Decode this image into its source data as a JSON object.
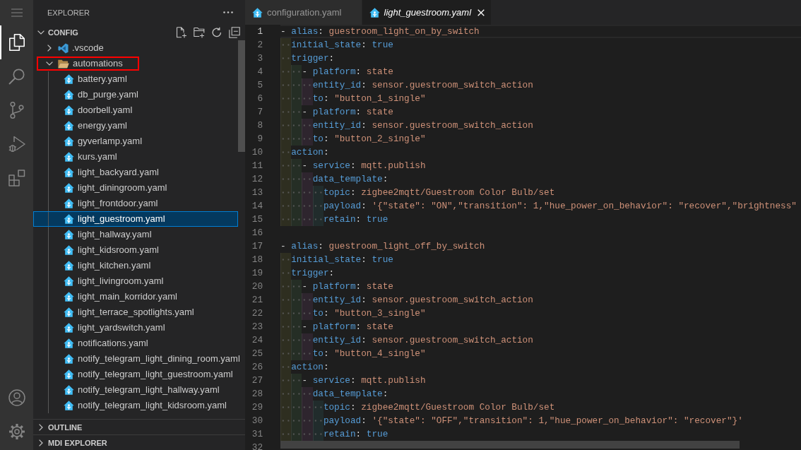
{
  "activity_bar": {
    "items": [
      {
        "kind": "explorer",
        "selected": true
      },
      {
        "kind": "search",
        "selected": false
      },
      {
        "kind": "scm",
        "selected": false
      },
      {
        "kind": "debug",
        "selected": false
      },
      {
        "kind": "extensions",
        "selected": false
      }
    ]
  },
  "sidebar": {
    "title": "EXPLORER",
    "sections": [
      {
        "title": "CONFIG",
        "expanded": true,
        "items": [
          {
            "label": ".vscode",
            "kind": "settings",
            "expanded": false,
            "selected": false,
            "outlined": false
          },
          {
            "label": "automations",
            "kind": "folder",
            "expanded": true,
            "selected": false,
            "outlined": true,
            "children": [
              {
                "label": "battery.yaml",
                "kind": "file",
                "selected": false
              },
              {
                "label": "db_purge.yaml",
                "kind": "file",
                "selected": false
              },
              {
                "label": "doorbell.yaml",
                "kind": "file",
                "selected": false
              },
              {
                "label": "energy.yaml",
                "kind": "file",
                "selected": false
              },
              {
                "label": "gyverlamp.yaml",
                "kind": "file",
                "selected": false
              },
              {
                "label": "kurs.yaml",
                "kind": "file",
                "selected": false
              },
              {
                "label": "light_backyard.yaml",
                "kind": "file",
                "selected": false
              },
              {
                "label": "light_diningroom.yaml",
                "kind": "file",
                "selected": false
              },
              {
                "label": "light_frontdoor.yaml",
                "kind": "file",
                "selected": false
              },
              {
                "label": "light_guestroom.yaml",
                "kind": "file",
                "selected": true
              },
              {
                "label": "light_hallway.yaml",
                "kind": "file",
                "selected": false
              },
              {
                "label": "light_kidsroom.yaml",
                "kind": "file",
                "selected": false
              },
              {
                "label": "light_kitchen.yaml",
                "kind": "file",
                "selected": false
              },
              {
                "label": "light_livingroom.yaml",
                "kind": "file",
                "selected": false
              },
              {
                "label": "light_main_korridor.yaml",
                "kind": "file",
                "selected": false
              },
              {
                "label": "light_terrace_spotlights.yaml",
                "kind": "file",
                "selected": false
              },
              {
                "label": "light_yardswitch.yaml",
                "kind": "file",
                "selected": false
              },
              {
                "label": "notifications.yaml",
                "kind": "file",
                "selected": false
              },
              {
                "label": "notify_telegram_light_dining_room.yaml",
                "kind": "file",
                "selected": false
              },
              {
                "label": "notify_telegram_light_guestroom.yaml",
                "kind": "file",
                "selected": false
              },
              {
                "label": "notify_telegram_light_hallway.yaml",
                "kind": "file",
                "selected": false
              },
              {
                "label": "notify_telegram_light_kidsroom.yaml",
                "kind": "file",
                "selected": false
              }
            ]
          }
        ]
      },
      {
        "title": "OUTLINE",
        "expanded": false
      },
      {
        "title": "MDI EXPLORER",
        "expanded": false
      }
    ]
  },
  "tabs": [
    {
      "label": "configuration.yaml",
      "selected": false,
      "preview": false
    },
    {
      "label": "light_guestroom.yaml",
      "selected": true,
      "preview": true
    }
  ],
  "editor": {
    "lines": [
      {
        "number": "1",
        "active": true,
        "tokens": [
          {
            "text": "- ",
            "kind": "punct"
          },
          {
            "text": "alias",
            "kind": "key"
          },
          {
            "text": ": ",
            "kind": "punct"
          },
          {
            "text": "guestroom_light_on_by_switch",
            "kind": "value"
          }
        ],
        "children": [
          {
            "number": "2",
            "active": false,
            "tokens": [
              {
                "text": "initial_state",
                "kind": "key"
              },
              {
                "text": ": ",
                "kind": "punct"
              },
              {
                "text": "true",
                "kind": "literal"
              }
            ]
          },
          {
            "number": "3",
            "active": false,
            "tokens": [
              {
                "text": "trigger",
                "kind": "key"
              },
              {
                "text": ":",
                "kind": "punct"
              }
            ],
            "children": [
              {
                "number": "4",
                "active": false,
                "tokens": [
                  {
                    "text": "- ",
                    "kind": "punct"
                  },
                  {
                    "text": "platform",
                    "kind": "key"
                  },
                  {
                    "text": ": ",
                    "kind": "punct"
                  },
                  {
                    "text": "state",
                    "kind": "value"
                  }
                ],
                "children": [
                  {
                    "number": "5",
                    "active": false,
                    "tokens": [
                      {
                        "text": "entity_id",
                        "kind": "key"
                      },
                      {
                        "text": ": ",
                        "kind": "punct"
                      },
                      {
                        "text": "sensor.guestroom_switch_action",
                        "kind": "value"
                      }
                    ]
                  },
                  {
                    "number": "6",
                    "active": false,
                    "tokens": [
                      {
                        "text": "to",
                        "kind": "key"
                      },
                      {
                        "text": ": ",
                        "kind": "punct"
                      },
                      {
                        "text": "\"button_1_single\"",
                        "kind": "value"
                      }
                    ]
                  }
                ]
              },
              {
                "number": "7",
                "active": false,
                "tokens": [
                  {
                    "text": "- ",
                    "kind": "punct"
                  },
                  {
                    "text": "platform",
                    "kind": "key"
                  },
                  {
                    "text": ": ",
                    "kind": "punct"
                  },
                  {
                    "text": "state",
                    "kind": "value"
                  }
                ],
                "children": [
                  {
                    "number": "8",
                    "active": false,
                    "tokens": [
                      {
                        "text": "entity_id",
                        "kind": "key"
                      },
                      {
                        "text": ": ",
                        "kind": "punct"
                      },
                      {
                        "text": "sensor.guestroom_switch_action",
                        "kind": "value"
                      }
                    ]
                  },
                  {
                    "number": "9",
                    "active": false,
                    "tokens": [
                      {
                        "text": "to",
                        "kind": "key"
                      },
                      {
                        "text": ": ",
                        "kind": "punct"
                      },
                      {
                        "text": "\"button_2_single\"",
                        "kind": "value"
                      }
                    ]
                  }
                ]
              }
            ]
          },
          {
            "number": "10",
            "active": false,
            "tokens": [
              {
                "text": "action",
                "kind": "key"
              },
              {
                "text": ":",
                "kind": "punct"
              }
            ],
            "children": [
              {
                "number": "11",
                "active": false,
                "tokens": [
                  {
                    "text": "- ",
                    "kind": "punct"
                  },
                  {
                    "text": "service",
                    "kind": "key"
                  },
                  {
                    "text": ": ",
                    "kind": "punct"
                  },
                  {
                    "text": "mqtt.publish",
                    "kind": "value"
                  }
                ],
                "children": [
                  {
                    "number": "12",
                    "active": false,
                    "tokens": [
                      {
                        "text": "data_template",
                        "kind": "key"
                      },
                      {
                        "text": ":",
                        "kind": "punct"
                      }
                    ],
                    "children": [
                      {
                        "number": "13",
                        "active": false,
                        "tokens": [
                          {
                            "text": "topic",
                            "kind": "key"
                          },
                          {
                            "text": ": ",
                            "kind": "punct"
                          },
                          {
                            "text": "zigbee2mqtt/Guestroom Color Bulb/set",
                            "kind": "value"
                          }
                        ]
                      },
                      {
                        "number": "14",
                        "active": false,
                        "tokens": [
                          {
                            "text": "payload",
                            "kind": "key"
                          },
                          {
                            "text": ": ",
                            "kind": "punct"
                          },
                          {
                            "text": "'{\"state\": \"ON\",\"transition\": 1,\"hue_power_on_behavior\": \"recover\",\"brightness\"",
                            "kind": "value"
                          }
                        ]
                      },
                      {
                        "number": "15",
                        "active": false,
                        "tokens": [
                          {
                            "text": "retain",
                            "kind": "key"
                          },
                          {
                            "text": ": ",
                            "kind": "punct"
                          },
                          {
                            "text": "true",
                            "kind": "literal"
                          }
                        ]
                      }
                    ]
                  }
                ]
              }
            ]
          }
        ]
      },
      {
        "number": "16",
        "active": false
      },
      {
        "number": "17",
        "active": false,
        "tokens": [
          {
            "text": "- ",
            "kind": "punct"
          },
          {
            "text": "alias",
            "kind": "key"
          },
          {
            "text": ": ",
            "kind": "punct"
          },
          {
            "text": "guestroom_light_off_by_switch",
            "kind": "value"
          }
        ],
        "children": [
          {
            "number": "18",
            "active": false,
            "tokens": [
              {
                "text": "initial_state",
                "kind": "key"
              },
              {
                "text": ": ",
                "kind": "punct"
              },
              {
                "text": "true",
                "kind": "literal"
              }
            ]
          },
          {
            "number": "19",
            "active": false,
            "tokens": [
              {
                "text": "trigger",
                "kind": "key"
              },
              {
                "text": ":",
                "kind": "punct"
              }
            ],
            "children": [
              {
                "number": "20",
                "active": false,
                "tokens": [
                  {
                    "text": "- ",
                    "kind": "punct"
                  },
                  {
                    "text": "platform",
                    "kind": "key"
                  },
                  {
                    "text": ": ",
                    "kind": "punct"
                  },
                  {
                    "text": "state",
                    "kind": "value"
                  }
                ],
                "children": [
                  {
                    "number": "21",
                    "active": false,
                    "tokens": [
                      {
                        "text": "entity_id",
                        "kind": "key"
                      },
                      {
                        "text": ": ",
                        "kind": "punct"
                      },
                      {
                        "text": "sensor.guestroom_switch_action",
                        "kind": "value"
                      }
                    ]
                  },
                  {
                    "number": "22",
                    "active": false,
                    "tokens": [
                      {
                        "text": "to",
                        "kind": "key"
                      },
                      {
                        "text": ": ",
                        "kind": "punct"
                      },
                      {
                        "text": "\"button_3_single\"",
                        "kind": "value"
                      }
                    ]
                  }
                ]
              },
              {
                "number": "23",
                "active": false,
                "tokens": [
                  {
                    "text": "- ",
                    "kind": "punct"
                  },
                  {
                    "text": "platform",
                    "kind": "key"
                  },
                  {
                    "text": ": ",
                    "kind": "punct"
                  },
                  {
                    "text": "state",
                    "kind": "value"
                  }
                ],
                "children": [
                  {
                    "number": "24",
                    "active": false,
                    "tokens": [
                      {
                        "text": "entity_id",
                        "kind": "key"
                      },
                      {
                        "text": ": ",
                        "kind": "punct"
                      },
                      {
                        "text": "sensor.guestroom_switch_action",
                        "kind": "value"
                      }
                    ]
                  },
                  {
                    "number": "25",
                    "active": false,
                    "tokens": [
                      {
                        "text": "to",
                        "kind": "key"
                      },
                      {
                        "text": ": ",
                        "kind": "punct"
                      },
                      {
                        "text": "\"button_4_single\"",
                        "kind": "value"
                      }
                    ]
                  }
                ]
              }
            ]
          },
          {
            "number": "26",
            "active": false,
            "tokens": [
              {
                "text": "action",
                "kind": "key"
              },
              {
                "text": ":",
                "kind": "punct"
              }
            ],
            "children": [
              {
                "number": "27",
                "active": false,
                "tokens": [
                  {
                    "text": "- ",
                    "kind": "punct"
                  },
                  {
                    "text": "service",
                    "kind": "key"
                  },
                  {
                    "text": ": ",
                    "kind": "punct"
                  },
                  {
                    "text": "mqtt.publish",
                    "kind": "value"
                  }
                ],
                "children": [
                  {
                    "number": "28",
                    "active": false,
                    "tokens": [
                      {
                        "text": "data_template",
                        "kind": "key"
                      },
                      {
                        "text": ":",
                        "kind": "punct"
                      }
                    ],
                    "children": [
                      {
                        "number": "29",
                        "active": false,
                        "tokens": [
                          {
                            "text": "topic",
                            "kind": "key"
                          },
                          {
                            "text": ": ",
                            "kind": "punct"
                          },
                          {
                            "text": "zigbee2mqtt/Guestroom Color Bulb/set",
                            "kind": "value"
                          }
                        ]
                      },
                      {
                        "number": "30",
                        "active": false,
                        "tokens": [
                          {
                            "text": "payload",
                            "kind": "key"
                          },
                          {
                            "text": ": ",
                            "kind": "punct"
                          },
                          {
                            "text": "'{\"state\": \"OFF\",\"transition\": 1,\"hue_power_on_behavior\": \"recover\"}'",
                            "kind": "value"
                          }
                        ]
                      },
                      {
                        "number": "31",
                        "active": false,
                        "tokens": [
                          {
                            "text": "retain",
                            "kind": "key"
                          },
                          {
                            "text": ": ",
                            "kind": "punct"
                          },
                          {
                            "text": "true",
                            "kind": "literal"
                          }
                        ]
                      }
                    ]
                  }
                ]
              }
            ]
          }
        ]
      },
      {
        "number": "32",
        "active": false
      }
    ]
  }
}
